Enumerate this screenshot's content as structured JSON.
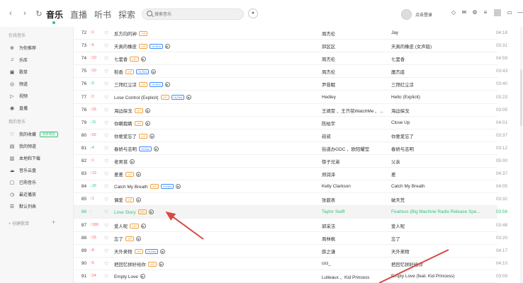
{
  "nav": {
    "back_icon": "chevron-left-icon",
    "forward_icon": "chevron-right-icon",
    "refresh_icon": "refresh-icon",
    "tabs": [
      {
        "label": "音乐",
        "active": true
      },
      {
        "label": "直播"
      },
      {
        "label": "听书"
      },
      {
        "label": "探索"
      }
    ],
    "search_placeholder": "搜索音乐",
    "user_label": "点击登录"
  },
  "sidebar": {
    "online_title": "在线音乐",
    "online_items": [
      {
        "label": "为你推荐",
        "icon": "recommend-icon"
      },
      {
        "label": "乐库",
        "icon": "library-icon"
      },
      {
        "label": "歌单",
        "icon": "playlist-icon"
      },
      {
        "label": "频道",
        "icon": "channel-icon"
      },
      {
        "label": "视频",
        "icon": "video-icon"
      },
      {
        "label": "直播",
        "icon": "live-icon"
      }
    ],
    "my_title": "我的音乐",
    "my_items": [
      {
        "label": "我的收藏",
        "icon": "heart-icon",
        "tag": "同步到云"
      },
      {
        "label": "我的频道",
        "icon": "radio-icon"
      },
      {
        "label": "本地和下载",
        "icon": "download-icon"
      },
      {
        "label": "音乐云盘",
        "icon": "cloud-icon"
      },
      {
        "label": "已购音乐",
        "icon": "purchase-icon"
      },
      {
        "label": "最近播放",
        "icon": "clock-icon"
      },
      {
        "label": "默认列表",
        "icon": "list-icon"
      }
    ],
    "create_playlist": "+ 创建歌单",
    "add": "+"
  },
  "songs": [
    {
      "num": "72",
      "rank": "↑2",
      "rank_dir": "up",
      "title": "反方向的钟",
      "badges": [
        "VIP"
      ],
      "singer": "周杰伦",
      "album": "Jay",
      "duration": "04:18"
    },
    {
      "num": "73",
      "rank": "↑5",
      "rank_dir": "up",
      "title": "天真的橡皮",
      "badges": [
        "VIP",
        "Hi-Res",
        "▶"
      ],
      "singer": "邱区区",
      "album": "天真的橡皮 (女声版)",
      "duration": "03:31"
    },
    {
      "num": "74",
      "rank": "↑10",
      "rank_dir": "up",
      "title": "七里香",
      "badges": [
        "VIP",
        "▶"
      ],
      "singer": "周杰伦",
      "album": "七里香",
      "duration": "04:59"
    },
    {
      "num": "75",
      "rank": "↑10",
      "rank_dir": "up",
      "title": "稻香",
      "badges": [
        "VIP",
        "Hi-Res",
        "▶"
      ],
      "singer": "周杰伦",
      "album": "魔杰座",
      "duration": "03:43"
    },
    {
      "num": "76",
      "rank": "↓5",
      "rank_dir": "down",
      "title": "三拜红尘凉",
      "badges": [
        "VIP",
        "Hi-Res",
        "▶"
      ],
      "singer": "尹昔眠",
      "album": "三拜红尘凉",
      "duration": "03:40"
    },
    {
      "num": "77",
      "rank": "↑2",
      "rank_dir": "up",
      "title": "Lose Control (Explicit)",
      "badges": [
        "VIP",
        "Hi-Res",
        "▶"
      ],
      "singer": "Hedley",
      "album": "Hello (Explicit)",
      "duration": "03:23"
    },
    {
      "num": "78",
      "rank": "↑15",
      "rank_dir": "up",
      "title": "海边探戈",
      "badges": [
        "VIP",
        "▶"
      ],
      "singer": "王靖雯 、王齐铭WatchMe 、...",
      "album": "海边探戈",
      "duration": "03:05"
    },
    {
      "num": "79",
      "rank": "↓11",
      "rank_dir": "down",
      "title": "你瞒我瞒",
      "badges": [
        "VIP",
        "▶"
      ],
      "singer": "陈柏宇",
      "album": "Close Up",
      "duration": "04:01"
    },
    {
      "num": "80",
      "rank": "↑52",
      "rank_dir": "up",
      "title": "你要爱忘了",
      "badges": [
        "VIP",
        "▶"
      ],
      "singer": "叔叔",
      "album": "你要爱忘了",
      "duration": "03:37"
    },
    {
      "num": "81",
      "rank": "↓4",
      "rank_dir": "down",
      "title": "春娇与志明",
      "badges": [
        "Hi-Res",
        "▶"
      ],
      "singer": "街道办GDC 、欧阳耀莹",
      "album": "春娇与志明",
      "duration": "03:12"
    },
    {
      "num": "82",
      "rank": "↑1",
      "rank_dir": "up",
      "title": "老男孩",
      "badges": [
        "▶"
      ],
      "singer": "筷子兄弟",
      "album": "父亲",
      "duration": "05:00"
    },
    {
      "num": "83",
      "rank": "↑13",
      "rank_dir": "up",
      "title": "差差",
      "badges": [
        "VIP",
        "▶"
      ],
      "singer": "郑润泽",
      "album": "差",
      "duration": "04:37"
    },
    {
      "num": "84",
      "rank": "↓16",
      "rank_dir": "down",
      "title": "Catch My Breath",
      "badges": [
        "VIP",
        "Hi-Res",
        "▶"
      ],
      "singer": "Kelly Clarkson",
      "album": "Catch My Breath",
      "duration": "04:05"
    },
    {
      "num": "85",
      "rank": "↑1",
      "rank_dir": "up",
      "title": "偶爱",
      "badges": [
        "VIP",
        "▶"
      ],
      "singer": "张碧表",
      "album": "破天荒",
      "duration": "03:32"
    },
    {
      "num": "86",
      "rank": "-",
      "rank_dir": "flat",
      "title": "Love Story",
      "badges": [
        "VIP",
        "▶"
      ],
      "singer": "Taylor Swift",
      "album": "Fearless (Big Machine Radio Release Spe...",
      "duration": "03:56",
      "active": true
    },
    {
      "num": "87",
      "rank": "↑180",
      "rank_dir": "up",
      "title": "爱人呢",
      "badges": [
        "VIP",
        "▶"
      ],
      "singer": "郭采洁",
      "album": "爱人呢",
      "duration": "03:48"
    },
    {
      "num": "88",
      "rank": "↑15",
      "rank_dir": "up",
      "title": "忘了",
      "badges": [
        "VIP",
        "▶"
      ],
      "singer": "周林枫",
      "album": "忘了",
      "duration": "03:20"
    },
    {
      "num": "89",
      "rank": "↑8",
      "rank_dir": "up",
      "title": "天外来物",
      "badges": [
        "VIP",
        "Hi-Res",
        "▶"
      ],
      "singer": "薛之谦",
      "album": "天外来物",
      "duration": "04:17"
    },
    {
      "num": "90",
      "rank": "↑6",
      "rank_dir": "up",
      "title": "把回忆拼好给你",
      "badges": [
        "VIP",
        "▶"
      ],
      "singer": "cici_",
      "album": "把回忆拼好给你",
      "duration": "04:10"
    },
    {
      "num": "91",
      "rank": "↑24",
      "rank_dir": "up",
      "title": "Empty Love",
      "badges": [
        "▶"
      ],
      "singer": "Lulleaux 、Kid Princess",
      "album": "Empty Love (feat. Kid Princess)",
      "duration": "03:09"
    }
  ]
}
